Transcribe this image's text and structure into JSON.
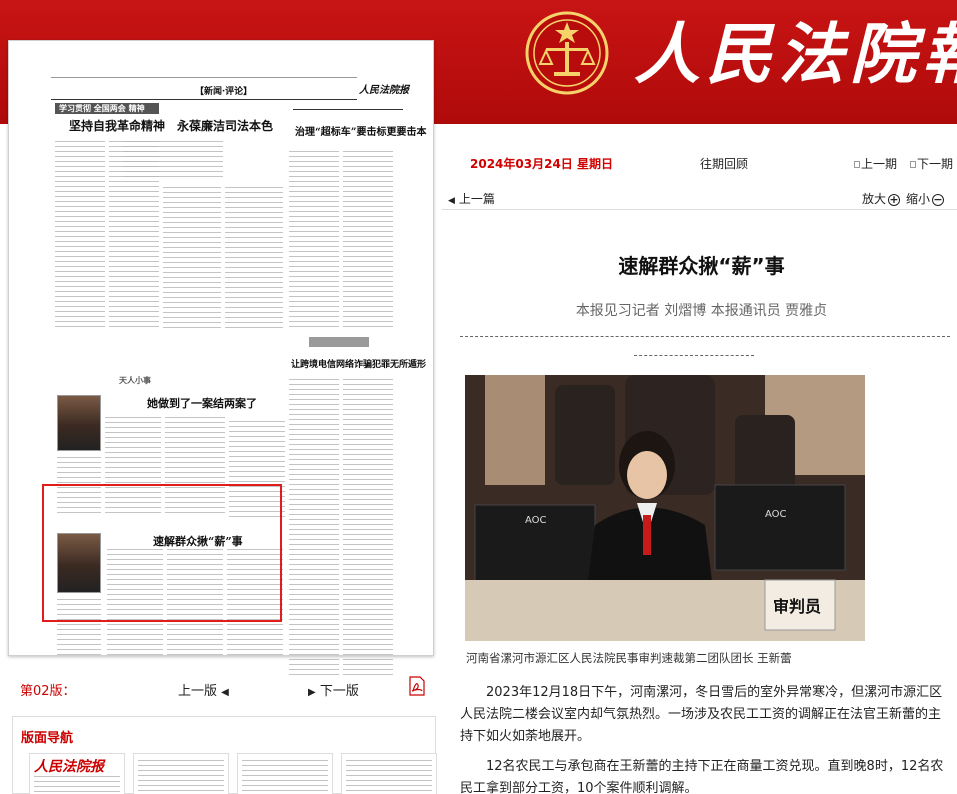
{
  "header": {
    "masthead": "人民法院報"
  },
  "paper": {
    "section_tag": "【新闻·评论】",
    "paper_name": "人民法院报",
    "column_tag": "学习贯彻 全国两会 精神",
    "headline_main": "坚持自我革命精神　永葆廉洁司法本色",
    "headline_right": "治理“超标车”要击标更要击本",
    "headline_fraud": "让跨境电信网络诈骗犯罪无所遁形",
    "feature_tag": "天人小事",
    "headline_feature": "她做到了一案结两案了",
    "headline_highlight": "速解群众揪“薪”事"
  },
  "edition": {
    "label": "第02版：",
    "prev": "上一版",
    "prev_arrow": "◀",
    "next": "下一版",
    "next_arrow": "▶"
  },
  "nav": {
    "title": "版面导航"
  },
  "date_row": {
    "date": "2024年03月24日 星期日",
    "archive": "往期回顾",
    "prev_period": "上一期",
    "next_period": "下一期"
  },
  "toolbar": {
    "prev_article": "上一篇",
    "zoom_in": "放大",
    "zoom_out": "缩小"
  },
  "article": {
    "title": "速解群众揪“薪”事",
    "byline": "本报见习记者 刘熠博 本报通讯员 贾雅贞",
    "photo_caption": "河南省漯河市源汇区人民法院民事审判速裁第二团队团长 王新蕾",
    "photo_sign": "审判员",
    "monitor_brand": "AOC",
    "paragraphs": [
      "2023年12月18日下午，河南漯河，冬日雪后的室外异常寒冷，但漯河市源汇区人民法院二楼会议室内却气氛热烈。一场涉及农民工工资的调解正在法官王新蕾的主持下如火如荼地展开。",
      "12名农民工与承包商在王新蕾的主持下正在商量工资兑现。直到晚8时，12名农民工拿到部分工资，10个案件顺利调解。"
    ]
  },
  "colors": {
    "brand_red": "#c81414",
    "date_red": "#d10000",
    "highlight_red": "#e21b1b"
  }
}
